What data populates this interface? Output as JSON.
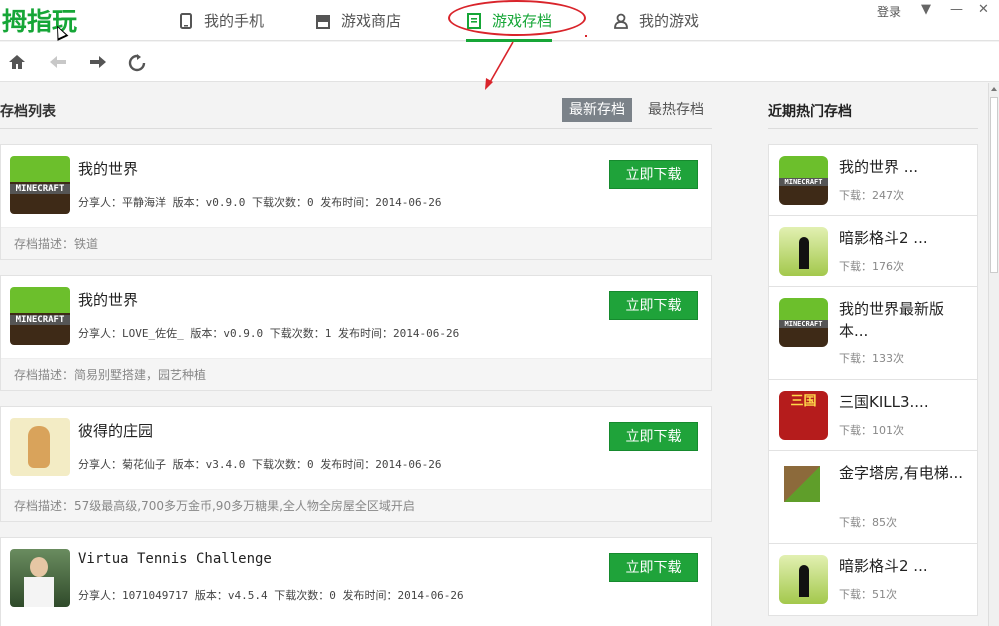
{
  "app": {
    "logo": "拇指玩",
    "nav": [
      {
        "label": "我的手机",
        "icon": "phone-icon"
      },
      {
        "label": "游戏商店",
        "icon": "store-icon"
      },
      {
        "label": "游戏存档",
        "icon": "archive-icon"
      },
      {
        "label": "我的游戏",
        "icon": "user-icon"
      }
    ],
    "active_nav": "游戏存档",
    "login": "登录",
    "window_controls": [
      "▼",
      "—",
      "✕"
    ],
    "accent_color": "#16a637",
    "annotation_color": "#d9242b"
  },
  "toolbar": {
    "icons": [
      "home-icon",
      "back-icon",
      "forward-icon",
      "refresh-icon"
    ]
  },
  "list": {
    "title": "存档列表",
    "sort": [
      "最新存档",
      "最热存档"
    ],
    "active_sort": "最新存档",
    "download_label": "立即下载",
    "items": [
      {
        "name": "我的世界",
        "meta": "分享人：平静海洋 版本：v0.9.0 下载次数：0 发布时间：2014-06-26",
        "desc": "存档描述：铁道",
        "thumb": "minecraft"
      },
      {
        "name": "我的世界",
        "meta": "分享人：LOVE_佐佐_ 版本：v0.9.0 下载次数：1 发布时间：2014-06-26",
        "desc": "存档描述：简易别墅搭建，园艺种植",
        "thumb": "minecraft"
      },
      {
        "name": "彼得的庄园",
        "meta": "分享人：菊花仙子 版本：v3.4.0 下载次数：0 发布时间：2014-06-26",
        "desc": "存档描述：57级最高级,700多万金币,90多万糖果,全人物全房屋全区域开启",
        "thumb": "rabbit"
      },
      {
        "name": "Virtua Tennis Challenge",
        "meta": "分享人：1071049717 版本：v4.5.4 下载次数：0 发布时间：2014-06-26",
        "desc": "",
        "thumb": "tennis"
      }
    ]
  },
  "sidebar": {
    "title": "近期热门存档",
    "items": [
      {
        "name": "我的世界 ...",
        "downloads": "下载：247次",
        "thumb": "minecraft"
      },
      {
        "name": "暗影格斗2 ...",
        "downloads": "下载：176次",
        "thumb": "shadow"
      },
      {
        "name": "我的世界最新版本...",
        "downloads": "下载：133次",
        "thumb": "minecraft"
      },
      {
        "name": "三国KILL3....",
        "downloads": "下载：101次",
        "thumb": "sanguo"
      },
      {
        "name": "金字塔房,有电梯...",
        "downloads": "下载：85次",
        "thumb": "pyramid"
      },
      {
        "name": "暗影格斗2 ...",
        "downloads": "下载：51次",
        "thumb": "shadow"
      }
    ]
  },
  "thumb_text": {
    "minecraft": "MINECRAFT",
    "sanguo": "三国"
  }
}
